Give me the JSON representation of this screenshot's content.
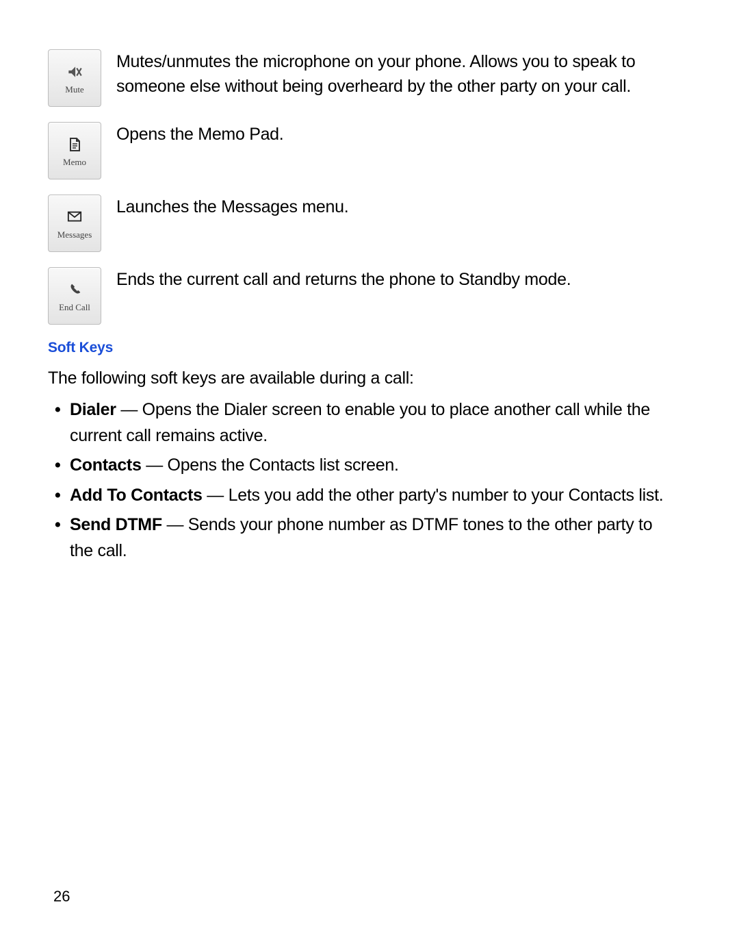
{
  "icons": [
    {
      "label": "Mute",
      "desc": "Mutes/unmutes the microphone on your phone. Allows you to speak to someone else without being overheard by the other party on your call."
    },
    {
      "label": "Memo",
      "desc": "Opens the Memo Pad."
    },
    {
      "label": "Messages",
      "desc": "Launches the Messages menu."
    },
    {
      "label": "End Call",
      "desc": "Ends the current call and returns the phone to Standby mode."
    }
  ],
  "section_heading": "Soft Keys",
  "intro_text": "The following soft keys are available during a call:",
  "bullets": [
    {
      "term": "Dialer",
      "desc": " — Opens the Dialer screen to enable you to place another call while the current call remains active."
    },
    {
      "term": "Contacts",
      "desc": " — Opens the Contacts list screen."
    },
    {
      "term": "Add To Contacts",
      "desc": " — Lets you add the other party's number to your Contacts list."
    },
    {
      "term": "Send DTMF",
      "desc": " — Sends your phone number as DTMF tones to the other party to the call."
    }
  ],
  "page_number": "26"
}
